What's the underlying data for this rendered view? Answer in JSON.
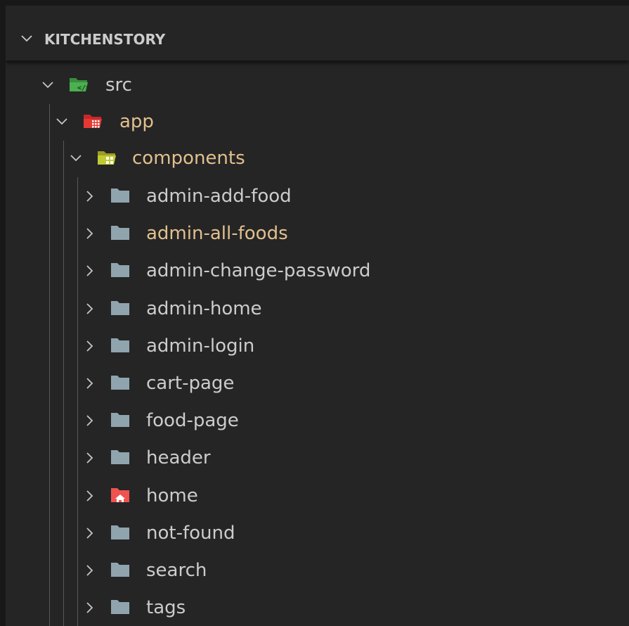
{
  "section": {
    "title": "KITCHENSTORY",
    "expanded": true
  },
  "tree": {
    "src": {
      "label": "src",
      "icon": "folder-src-open-icon",
      "icon_color": "#4caf50"
    },
    "app": {
      "label": "app",
      "icon": "folder-app-open-icon",
      "icon_color": "#e53935"
    },
    "components": {
      "label": "components",
      "icon": "folder-components-open-icon",
      "icon_color": "#c0ca33"
    },
    "children": [
      {
        "label": "admin-add-food",
        "icon": "folder-icon",
        "modified": false
      },
      {
        "label": "admin-all-foods",
        "icon": "folder-icon",
        "modified": true
      },
      {
        "label": "admin-change-password",
        "icon": "folder-icon",
        "modified": false
      },
      {
        "label": "admin-home",
        "icon": "folder-icon",
        "modified": false
      },
      {
        "label": "admin-login",
        "icon": "folder-icon",
        "modified": false
      },
      {
        "label": "cart-page",
        "icon": "folder-icon",
        "modified": false
      },
      {
        "label": "food-page",
        "icon": "folder-icon",
        "modified": false
      },
      {
        "label": "header",
        "icon": "folder-icon",
        "modified": false
      },
      {
        "label": "home",
        "icon": "folder-home-icon",
        "modified": false
      },
      {
        "label": "not-found",
        "icon": "folder-icon",
        "modified": false
      },
      {
        "label": "search",
        "icon": "folder-icon",
        "modified": false
      },
      {
        "label": "tags",
        "icon": "folder-icon",
        "modified": false
      }
    ]
  },
  "colors": {
    "background": "#252526",
    "text": "#cccccc",
    "modified_text": "#e2c08d",
    "folder_gray": "#90a4ae",
    "folder_home": "#ef5350",
    "indent_guide": "#585858"
  }
}
